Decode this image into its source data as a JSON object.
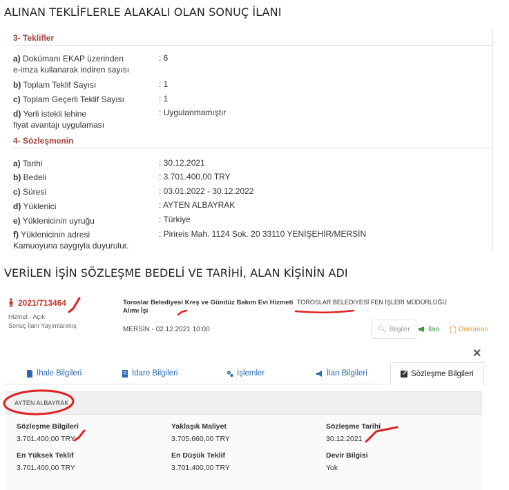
{
  "headings": {
    "top": "ALINAN TEKLİFLERLE ALAKALI OLAN SONUÇ İLANI",
    "bottom": "VERİLEN İŞİN SÖZLEŞME BEDELİ VE TARİHİ, ALAN KİŞİNİN ADI"
  },
  "offers": {
    "title": "3- Teklifler",
    "rows": [
      {
        "key": "a)",
        "label_line1": "Dokümanı EKAP üzerinden",
        "label_line2": "e-imza kullanarak indiren sayısı",
        "value": ": 6"
      },
      {
        "key": "b)",
        "label_line1": "Toplam Teklif Sayısı",
        "label_line2": "",
        "value": ": 1"
      },
      {
        "key": "c)",
        "label_line1": "Toplam Geçerli Teklif Sayısı",
        "label_line2": "",
        "value": ": 1"
      },
      {
        "key": "d)",
        "label_line1": "Yerli istekli lehine",
        "label_line2": "fiyat avantajı uygulaması",
        "value": ": Uygulanmamıştır"
      }
    ]
  },
  "contract": {
    "title": "4- Sözleşmenin",
    "rows": [
      {
        "key": "a)",
        "label": "Tarihi",
        "value": ": 30.12.2021"
      },
      {
        "key": "b)",
        "label": "Bedeli",
        "value": ": 3.701.400,00 TRY"
      },
      {
        "key": "c)",
        "label": "Süresi",
        "value": ": 03.01.2022 - 30.12.2022"
      },
      {
        "key": "d)",
        "label": "Yüklenici",
        "value": ": AYTEN ALBAYRAK"
      },
      {
        "key": "e)",
        "label": "Yüklenicinin uyruğu",
        "value": ": Türkiye"
      },
      {
        "key": "f)",
        "label": "Yüklenicinin adresi",
        "value": ": Pirireis Mah. 1124 Sok. 20 33110 YENİŞEHİR/MERSİN"
      }
    ],
    "closing": "Kamuoyuna saygıyla duyurulur."
  },
  "tender": {
    "ikn": "2021/713464",
    "type": "Hizmet - Açık",
    "status": "Sonuç İlanı Yayımlanmış",
    "work_title": "Toroslar Belediyesi Kreş ve Gündüz Bakım Evi Hizmeti Alımı İşi",
    "administration": "TOROSLAR BELEDİYESİ FEN İŞLERİ MÜDÜRLÜĞÜ",
    "location_date": "MERSİN - 02.12.2021 10:00",
    "tools": {
      "info": "Bilgiler",
      "announcement": "İlan",
      "document": "Doküman"
    },
    "close_glyph": "✕"
  },
  "tabs": [
    {
      "label": "İhale Bilgileri",
      "icon": "document-icon"
    },
    {
      "label": "İdare Bilgileri",
      "icon": "building-icon"
    },
    {
      "label": "İşlemler",
      "icon": "gears-icon"
    },
    {
      "label": "İlan Bilgileri",
      "icon": "megaphone-icon"
    },
    {
      "label": "Sözleşme Bilgileri",
      "icon": "edit-icon",
      "active": true
    }
  ],
  "contract_info": {
    "winner": "AYTEN ALBAYRAK",
    "fields": [
      {
        "label": "Sözleşme Bilgileri",
        "value": "3.701.400,00 TRY"
      },
      {
        "label": "Yaklaşık Maliyet",
        "value": "3.705.660,00 TRY"
      },
      {
        "label": "Sözleşme Tarihi",
        "value": "30.12.2021"
      },
      {
        "label": "En Yüksek Teklif",
        "value": "3.701.400,00 TRY"
      },
      {
        "label": "En Düşük Teklif",
        "value": "3.701.400,00 TRY"
      },
      {
        "label": "Devir Bilgisi",
        "value": "Yok"
      }
    ]
  },
  "colors": {
    "section_title": "#a0403a",
    "ikn": "#c0392b",
    "tab_link": "#2a6ab0",
    "annotation_red": "#e02020"
  }
}
